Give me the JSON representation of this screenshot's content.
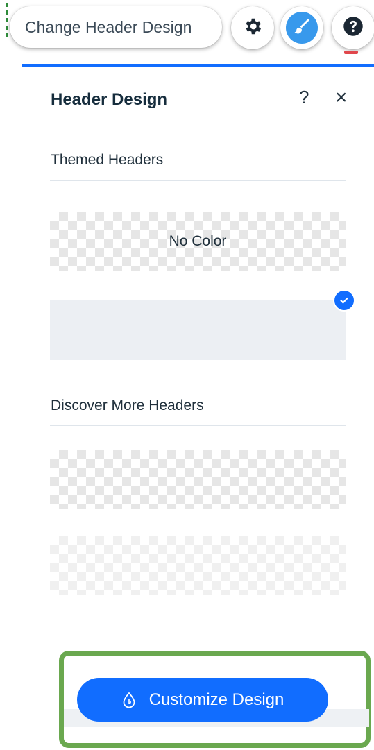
{
  "toolbar": {
    "change_header_label": "Change Header Design",
    "settings_icon": "gear-icon",
    "design_icon": "paintbrush-icon",
    "help_icon": "question-icon"
  },
  "panel": {
    "title": "Header Design",
    "help_symbol": "?",
    "close_symbol": "×",
    "themed_headers": {
      "title": "Themed Headers",
      "options": [
        {
          "label": "No Color",
          "style": "transparent",
          "selected": false
        },
        {
          "label": "",
          "style": "solid",
          "color": "#eceff3",
          "selected": true
        }
      ]
    },
    "discover": {
      "title": "Discover More Headers"
    },
    "customize_button_label": "Customize Design"
  },
  "colors": {
    "accent": "#116dff",
    "highlight_frame": "#6aa84f"
  }
}
